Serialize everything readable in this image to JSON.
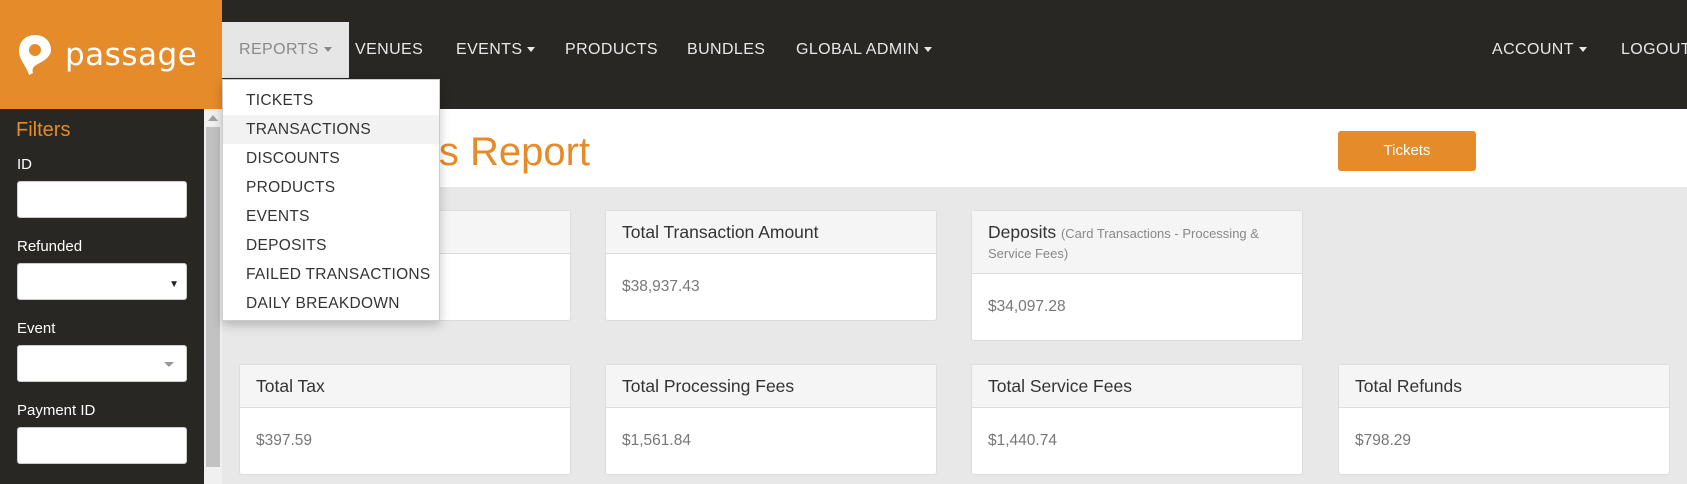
{
  "brand": {
    "name": "passage"
  },
  "nav": {
    "left": [
      {
        "label": "REPORTS",
        "caret": true
      },
      {
        "label": "VENUES",
        "caret": false
      },
      {
        "label": "EVENTS",
        "caret": true
      },
      {
        "label": "PRODUCTS",
        "caret": false
      },
      {
        "label": "BUNDLES",
        "caret": false
      },
      {
        "label": "GLOBAL ADMIN",
        "caret": true
      }
    ],
    "right": [
      {
        "label": "ACCOUNT",
        "caret": true
      },
      {
        "label": "LOGOUT",
        "caret": false
      }
    ]
  },
  "reports_menu": [
    "TICKETS",
    "TRANSACTIONS",
    "DISCOUNTS",
    "PRODUCTS",
    "EVENTS",
    "DEPOSITS",
    "FAILED TRANSACTIONS",
    "DAILY BREAKDOWN"
  ],
  "filters": {
    "title": "Filters",
    "fields": [
      {
        "label": "ID",
        "type": "text",
        "value": ""
      },
      {
        "label": "Refunded",
        "type": "select",
        "value": ""
      },
      {
        "label": "Event",
        "type": "select",
        "value": ""
      },
      {
        "label": "Payment ID",
        "type": "text",
        "value": ""
      }
    ]
  },
  "page": {
    "title_visible": "s Report",
    "button": "Tickets"
  },
  "cards": [
    {
      "title": "",
      "note": "",
      "value": ""
    },
    {
      "title": "Total Transaction Amount",
      "note": "",
      "value": "$38,937.43"
    },
    {
      "title": "Deposits",
      "note": "(Card Transactions - Processing & Service Fees)",
      "value": "$34,097.28"
    },
    {
      "title": "Total Tax",
      "note": "",
      "value": "$397.59"
    },
    {
      "title": "Total Processing Fees",
      "note": "",
      "value": "$1,561.84"
    },
    {
      "title": "Total Service Fees",
      "note": "",
      "value": "$1,440.74"
    },
    {
      "title": "Total Refunds",
      "note": "",
      "value": "$798.29"
    }
  ],
  "colors": {
    "brand": "#e58b2a",
    "navbar": "#292724",
    "sidebar": "#292724",
    "content_bg": "#e8e8e8"
  }
}
